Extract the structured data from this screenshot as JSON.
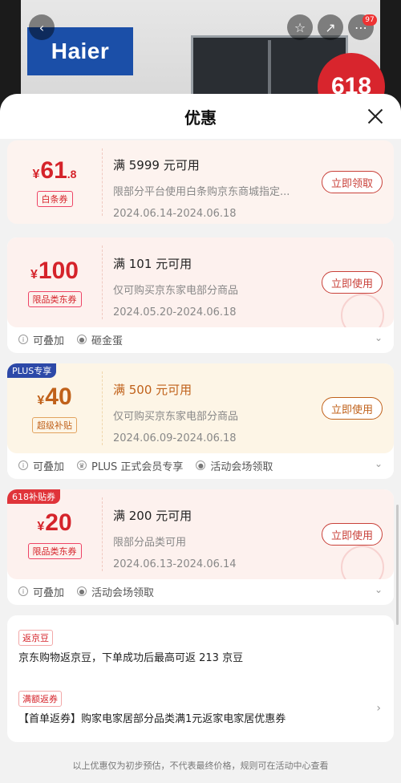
{
  "header": {
    "title": "优惠",
    "more_badge": "97"
  },
  "background": {
    "brand": "Haier",
    "promo_badge": "618"
  },
  "icons": {
    "back": "chevron-left-icon",
    "star": "star-icon",
    "share": "share-icon",
    "more": "more-icon",
    "close": "close-icon"
  },
  "coupons": [
    {
      "yen": "¥",
      "amount": "61",
      "amount_dec": ".8",
      "tag": "白条券",
      "condition": "满 5999 元可用",
      "desc": "限部分平台使用白条购京东商城指定...",
      "dates": "2024.06.14-2024.06.18",
      "action": "立即领取"
    },
    {
      "yen": "¥",
      "amount": "100",
      "tag": "限品类东券",
      "condition": "满 101 元可用",
      "desc": "仅可购买京东家电部分商品",
      "dates": "2024.05.20-2024.06.18",
      "action": "立即使用",
      "foot": [
        "可叠加",
        "砸金蛋"
      ]
    },
    {
      "badge": "PLUS专享",
      "yen": "¥",
      "amount": "40",
      "tag": "超级补贴",
      "condition": "满 500 元可用",
      "desc": "仅可购买京东家电部分商品",
      "dates": "2024.06.09-2024.06.18",
      "action": "立即使用",
      "foot": [
        "可叠加",
        "PLUS 正式会员专享",
        "活动会场领取"
      ]
    },
    {
      "badge": "618补贴券",
      "yen": "¥",
      "amount": "20",
      "tag": "限品类东券",
      "condition": "满 200 元可用",
      "desc": "限部分品类可用",
      "dates": "2024.06.13-2024.06.14",
      "action": "立即使用",
      "foot": [
        "可叠加",
        "活动会场领取"
      ]
    }
  ],
  "info": {
    "tag1": "返京豆",
    "text1": "京东购物返京豆，下单成功后最高可返 213 京豆",
    "tag2": "满额返券",
    "text2": "【首单返券】购家电家居部分品类满1元返家电家居优惠券"
  },
  "disclaimer": "以上优惠仅为初步预估，不代表最终价格，规则可在活动中心查看"
}
